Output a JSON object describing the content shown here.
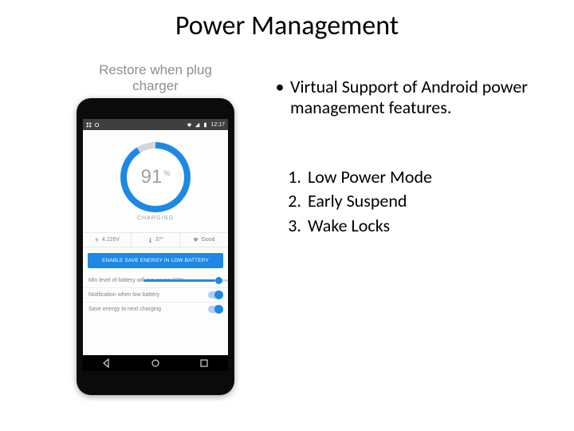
{
  "title": "Power Management",
  "left": {
    "caption_l1": "Restore when plug",
    "caption_l2": "charger",
    "status_time": "12:17",
    "gauge_pct": "91",
    "pct_unit": "%",
    "charging_label": "CHARGING",
    "stats": {
      "voltage": "4.226V",
      "temp": "37°",
      "health": "Good"
    },
    "button": "ENABLE SAVE ENERGY IN LOW BATTERY",
    "settings": {
      "s1": "Min level of battery will run saver: 90%",
      "s2": "Notification when low battery",
      "s3": "Save energy to next charging"
    }
  },
  "right": {
    "bullet": "Virtual Support of Android power management features.",
    "items": {
      "n1": "1.",
      "n2": "2.",
      "n3": "3.",
      "t1": "Low Power Mode",
      "t2": "Early Suspend",
      "t3": "Wake Locks"
    }
  }
}
